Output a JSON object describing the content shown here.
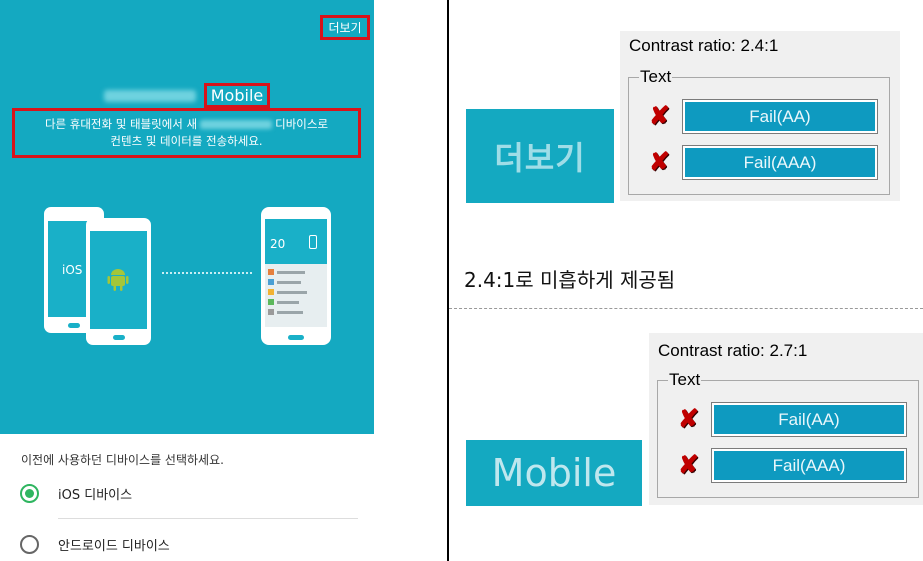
{
  "phone": {
    "more_button": "더보기",
    "title_word": "Mobile",
    "description_line1_a": "다른 휴대전화 및 태블릿에서 새",
    "description_line1_b": "디바이스로",
    "description_line2": "컨텐츠 및 데이터를 전송하세요.",
    "ios_label": "iOS",
    "screen_temp": "20",
    "prompt": "이전에 사용하던 디바이스를 선택하세요.",
    "options": [
      {
        "label": "iOS 디바이스",
        "selected": true
      },
      {
        "label": "안드로이드 디바이스",
        "selected": false
      }
    ]
  },
  "colors": {
    "teal": "#14a9c1",
    "highlight_border": "#d8131a",
    "fail_button": "#0e9ac0",
    "fail_mark": "#c00000"
  },
  "note": "2.4:1로 미흡하게 제공됨",
  "checks": [
    {
      "sample_text": "더보기",
      "ratio_label": "Contrast ratio: 2.4:1",
      "group_label": "Text",
      "results": [
        "Fail(AA)",
        "Fail(AAA)"
      ]
    },
    {
      "sample_text": "Mobile",
      "ratio_label": "Contrast ratio: 2.7:1",
      "group_label": "Text",
      "results": [
        "Fail(AA)",
        "Fail(AAA)"
      ]
    }
  ]
}
